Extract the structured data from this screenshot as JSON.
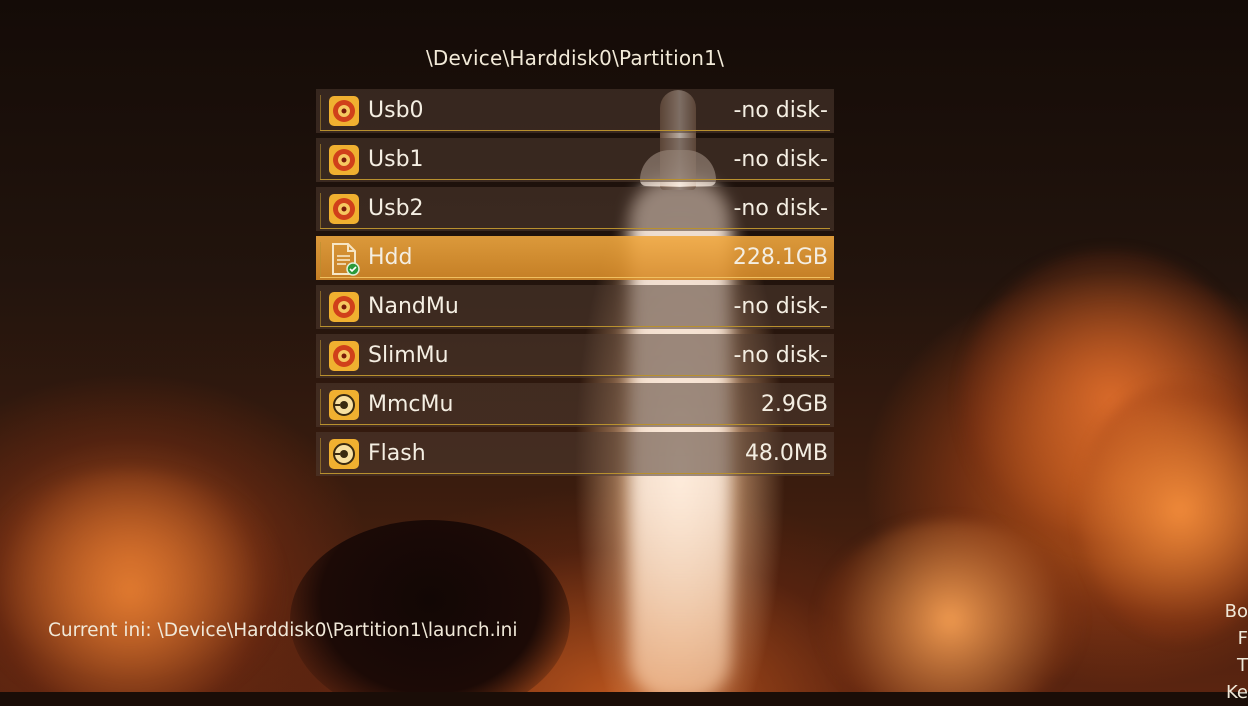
{
  "header": {
    "path": "\\Device\\Harddisk0\\Partition1\\"
  },
  "devices": [
    {
      "label": "Usb0",
      "value": "-no disk-",
      "icon": "usb-disk-icon",
      "selected": false
    },
    {
      "label": "Usb1",
      "value": "-no disk-",
      "icon": "usb-disk-icon",
      "selected": false
    },
    {
      "label": "Usb2",
      "value": "-no disk-",
      "icon": "usb-disk-icon",
      "selected": false
    },
    {
      "label": "Hdd",
      "value": "228.1GB",
      "icon": "hdd-file-icon",
      "selected": true
    },
    {
      "label": "NandMu",
      "value": "-no disk-",
      "icon": "usb-disk-icon",
      "selected": false
    },
    {
      "label": "SlimMu",
      "value": "-no disk-",
      "icon": "usb-disk-icon",
      "selected": false
    },
    {
      "label": "MmcMu",
      "value": "2.9GB",
      "icon": "disc-drive-icon",
      "selected": false
    },
    {
      "label": "Flash",
      "value": "48.0MB",
      "icon": "disc-drive-icon",
      "selected": false
    }
  ],
  "footer": {
    "current_ini": "Current ini:  \\Device\\Harddisk0\\Partition1\\launch.ini"
  },
  "side_hint": {
    "lines": [
      "Bo",
      "F",
      "T",
      "Ke"
    ]
  },
  "colors": {
    "accent": "#b8902e",
    "selected": "#e6a040",
    "text": "#f4eee2"
  }
}
